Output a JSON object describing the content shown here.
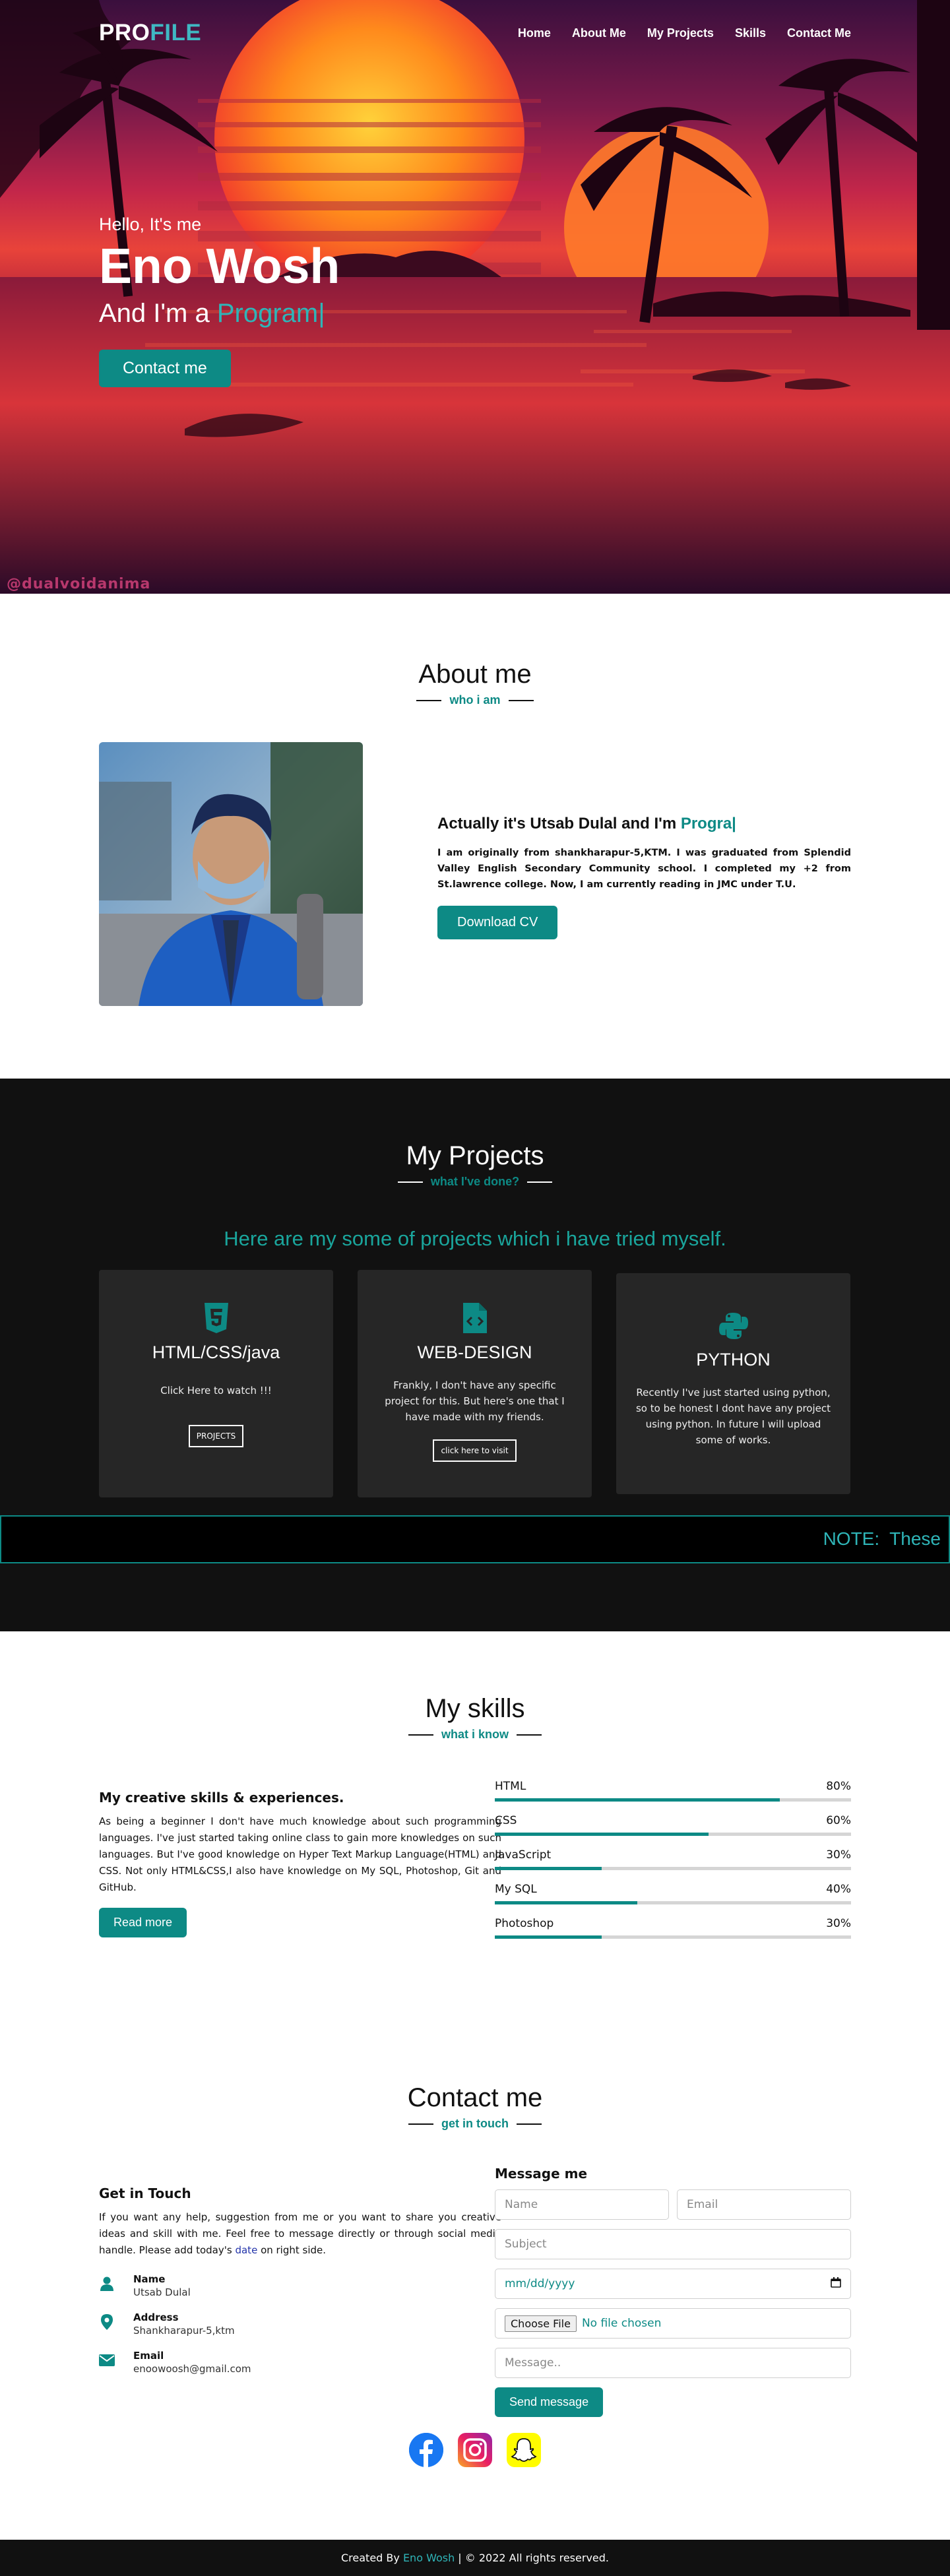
{
  "nav": {
    "logo_main": "PRO",
    "logo_accent": "FILE",
    "items": [
      "Home",
      "About Me",
      "My Projects",
      "Skills",
      "Contact Me"
    ]
  },
  "hero": {
    "hello": "Hello, It's me",
    "name": "Eno Wosh",
    "role_prefix": "And I'm a ",
    "role_typed": "Program|",
    "button": "Contact me",
    "watermark": "@dualvoidanima"
  },
  "about": {
    "title": "About me",
    "subtitle": "who i am",
    "heading_prefix": "Actually it's Utsab Dulal and I'm ",
    "heading_typed": "Progra|",
    "paragraph": "I am originally from shankharapur-5,KTM. I was graduated from Splendid Valley English Secondary Community school. I completed my +2 from St.lawrence college. Now, I am currently reading in JMC under T.U.",
    "button": "Download CV"
  },
  "projects": {
    "title": "My Projects",
    "subtitle": "what I've done?",
    "intro": "Here are my some of projects which i have tried myself.",
    "cards": [
      {
        "icon": "html5-icon",
        "title": "HTML/CSS/java",
        "text": "Click Here to watch !!!",
        "button": "PROJECTS"
      },
      {
        "icon": "code-file-icon",
        "title": "WEB-DESIGN",
        "text": "Frankly, I don't have any specific project for this. But here's one that I have made with my friends.",
        "button": "click here to visit"
      },
      {
        "icon": "python-icon",
        "title": "PYTHON",
        "text": "Recently I've just started using python, so to be honest I dont have any project using python. In future I will upload some of works.",
        "button": ""
      }
    ],
    "note": "NOTE:  These"
  },
  "skills": {
    "title": "My skills",
    "subtitle": "what i know",
    "heading": "My creative skills & experiences.",
    "paragraph": "As being a beginner I don't have much knowledge about such programming languages. I've just started taking online class to gain more knowledges on such languages. But I've good knowledge on Hyper Text Markup Language(HTML) and CSS. Not only HTML&CSS,I also have knowledge on My SQL, Photoshop, Git and GitHub.",
    "button": "Read more",
    "bars": [
      {
        "name": "HTML",
        "percent": "80%",
        "value": 80
      },
      {
        "name": "CSS",
        "percent": "60%",
        "value": 60
      },
      {
        "name": "JavaScript",
        "percent": "30%",
        "value": 30
      },
      {
        "name": "My SQL",
        "percent": "40%",
        "value": 40
      },
      {
        "name": "Photoshop",
        "percent": "30%",
        "value": 30
      }
    ]
  },
  "contact": {
    "title": "Contact me",
    "subtitle": "get in touch",
    "heading": "Get in Touch",
    "paragraph_start": "If you want any help, suggestion from me or you want to share you creative ideas and skill with me. Feel free to message directly or through social media handle. Please add today's ",
    "paragraph_link": "date",
    "paragraph_end": " on right side.",
    "info": [
      {
        "label": "Name",
        "value": "Utsab Dulal"
      },
      {
        "label": "Address",
        "value": "Shankharapur-5,ktm"
      },
      {
        "label": "Email",
        "value": "enoowoosh@gmail.com"
      }
    ],
    "form": {
      "heading": "Message me",
      "name_placeholder": "Name",
      "email_placeholder": "Email",
      "subject_placeholder": "Subject",
      "date_placeholder": "mm/dd/yyyy",
      "file_button": "Choose File",
      "file_status": "No file chosen",
      "message_placeholder": "Message..",
      "send": "Send message"
    }
  },
  "footer": {
    "prefix": "Created By ",
    "name": "Eno Wosh",
    "suffix": " | © 2022 All rights reserved."
  },
  "colors": {
    "accent": "#0d8a85",
    "dark": "#111111",
    "card": "#262626"
  }
}
